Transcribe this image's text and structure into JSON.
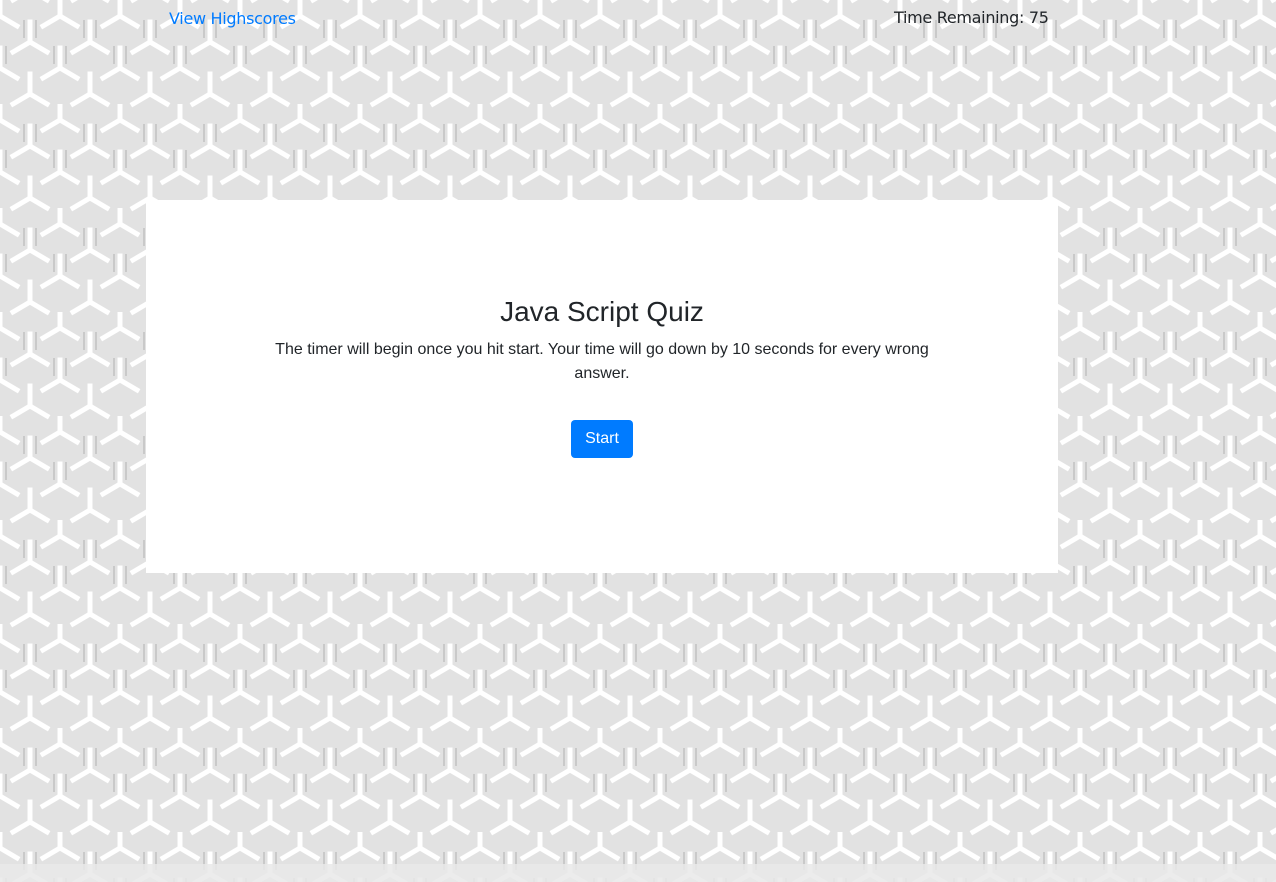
{
  "header": {
    "highscores_link": "View Highscores",
    "timer_label": "Time Remaining: ",
    "timer_value": "75"
  },
  "quiz": {
    "title": "Java Script Quiz",
    "description": "The timer will begin once you hit start. Your time will go down by 10 seconds for every wrong answer.",
    "start_label": "Start"
  },
  "colors": {
    "link": "#007bff",
    "button_bg": "#007bff",
    "button_text": "#ffffff",
    "card_bg": "#ffffff",
    "text": "#212529",
    "pattern_bg": "#e2e2e2"
  }
}
